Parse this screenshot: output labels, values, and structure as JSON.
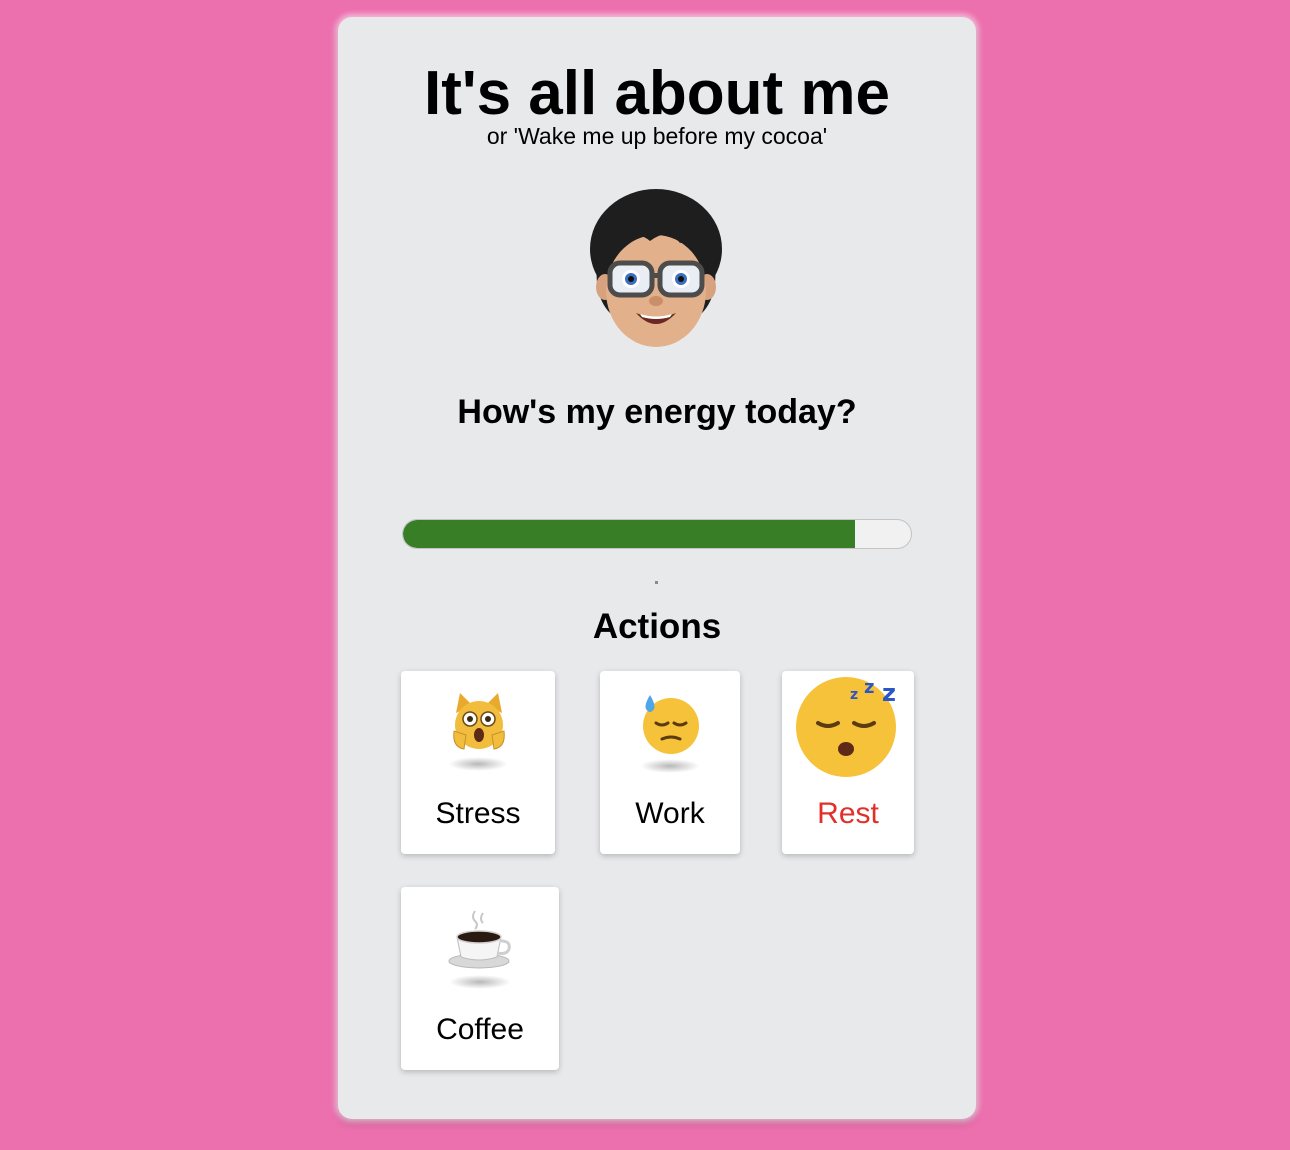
{
  "header": {
    "title": "It's all about me",
    "subtitle": "or 'Wake me up before my cocoa'"
  },
  "avatar": {
    "icon": "memoji-avatar-icon"
  },
  "energy": {
    "question": "How's my energy today?",
    "level_percent": 89,
    "fill_color": "#377e27",
    "track_color": "#f1f1f1"
  },
  "actions": {
    "title": "Actions",
    "items": [
      {
        "label": "Stress",
        "icon": "weary-cat-icon",
        "active": false
      },
      {
        "label": "Work",
        "icon": "downcast-sweat-face-icon",
        "active": false
      },
      {
        "label": "Rest",
        "icon": "sleeping-face-icon",
        "active": true
      },
      {
        "label": "Coffee",
        "icon": "hot-beverage-icon",
        "active": false
      }
    ],
    "active_color": "#e0302a"
  },
  "colors": {
    "background": "#ec6fae",
    "card": "#e8e9eb"
  }
}
